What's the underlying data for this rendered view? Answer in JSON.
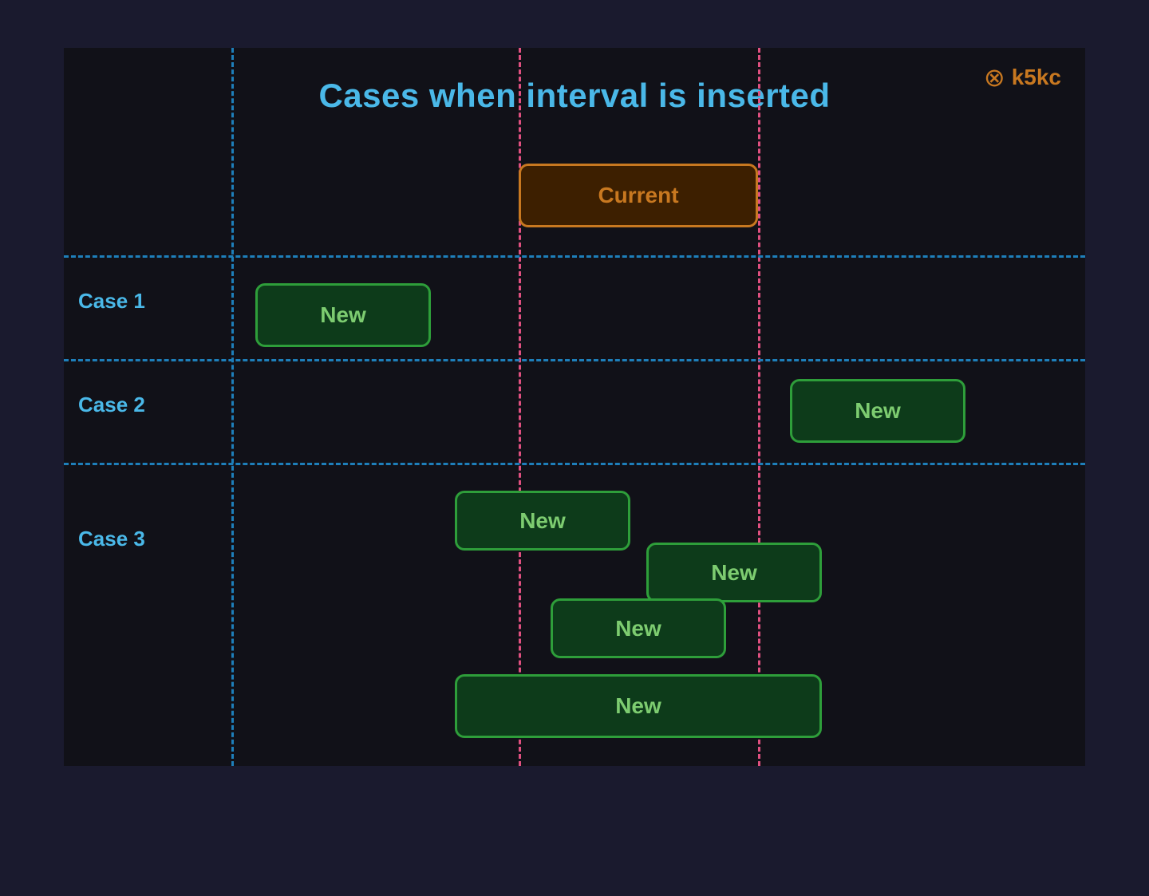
{
  "title": "Cases when interval is inserted",
  "logo": {
    "icon": "⊗",
    "text": "k5kc"
  },
  "colors": {
    "bg": "#111118",
    "gridBlue": "#1e7fba",
    "gridPink": "#e05080",
    "currentBg": "#3d1f00",
    "currentBorder": "#c87820",
    "currentText": "#c87820",
    "newBg": "#0d3b1a",
    "newBorder": "#2e9e3a",
    "newText": "#7dcc70",
    "caseLabel": "#4ab8e8",
    "titleColor": "#4ab8e8"
  },
  "cases": [
    {
      "label": "Case 1"
    },
    {
      "label": "Case 2"
    },
    {
      "label": "Case 3"
    }
  ],
  "boxes": [
    {
      "id": "current",
      "text": "Current",
      "type": "current"
    },
    {
      "id": "new1",
      "text": "New",
      "type": "new"
    },
    {
      "id": "new2",
      "text": "New",
      "type": "new"
    },
    {
      "id": "new3a",
      "text": "New",
      "type": "new"
    },
    {
      "id": "new3b",
      "text": "New",
      "type": "new"
    },
    {
      "id": "new3c",
      "text": "New",
      "type": "new"
    },
    {
      "id": "new3d",
      "text": "New",
      "type": "new"
    }
  ]
}
